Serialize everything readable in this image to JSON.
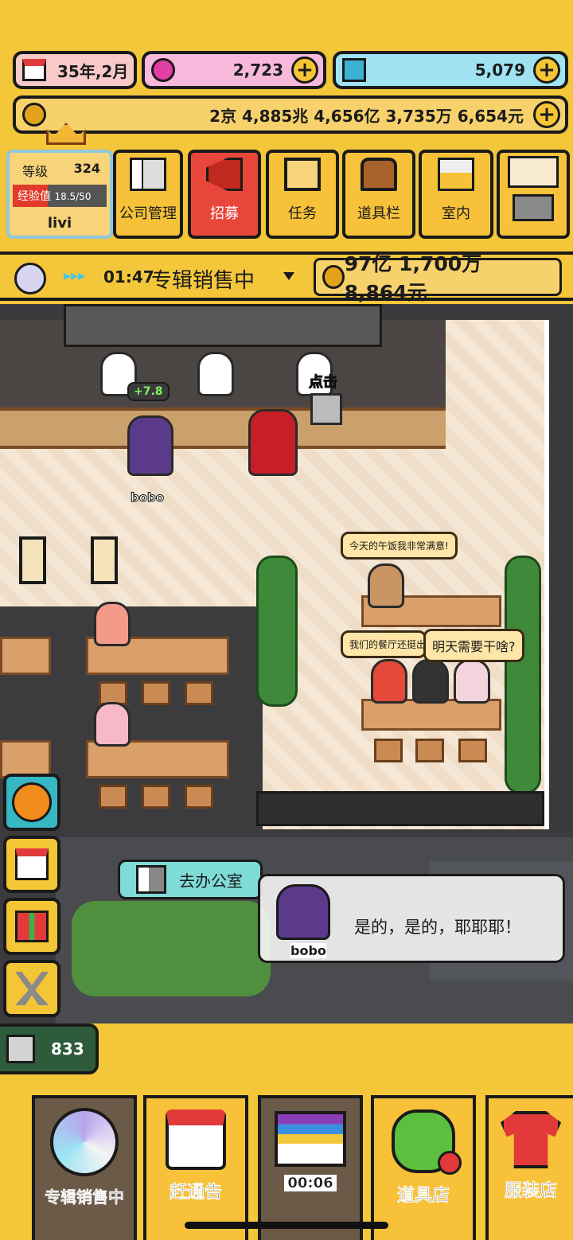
{
  "top_bar": {
    "date": "35年,2月",
    "gems_pink": "2,723",
    "gems_blue": "5,079",
    "money": "2京 4,885兆 4,656亿 3,735万 6,654元",
    "plus": "+"
  },
  "player": {
    "level_label": "等级",
    "level": "324",
    "exp_label": "经验值",
    "exp_value": "18.5/50",
    "exp_fraction": 0.37,
    "name": "livi"
  },
  "menu": {
    "company": "公司管理",
    "recruit": "招募",
    "tasks": "任务",
    "items": "道具栏",
    "interior": "室内"
  },
  "status": {
    "arrows": "▸▸▸",
    "timer": "01:47",
    "activity": "专辑销售中",
    "earnings": "97亿 1,700万 8,864元"
  },
  "scene": {
    "plus_badge": "+7.8",
    "click_hint": "点击",
    "character_name": "bobo",
    "bubble_1": "今天的午饭我非常满意!",
    "bubble_2": "我们的餐厅还挺出名的",
    "bubble_3": "明天需要干啥?"
  },
  "go_office": "去办公室",
  "dialog": {
    "speaker": "bobo",
    "text": "是的，是的，耶耶耶！"
  },
  "cat_count": "833",
  "bottom_nav": {
    "album": "专辑销售中",
    "notice": "赶通告",
    "timer": "00:06",
    "shop": "道具店",
    "clothes": "服装店"
  },
  "colors": {
    "background": "#f4c63a",
    "recruit_red": "#e8463a",
    "pink_pill": "#f7b8dc",
    "blue_pill": "#9fe3f2"
  }
}
